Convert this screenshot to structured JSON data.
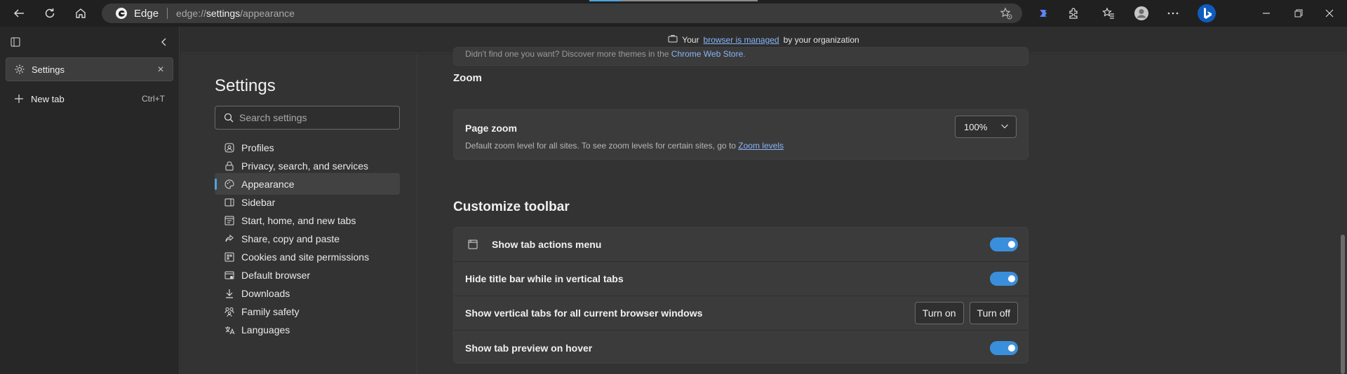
{
  "browser": {
    "name": "Edge",
    "url_prefix": "edge://",
    "url_main": "settings",
    "url_suffix": "/appearance"
  },
  "vertical_tabs": {
    "tabs": [
      {
        "label": "Settings",
        "close": "✕"
      },
      {
        "label": "New tab",
        "shortcut": "Ctrl+T"
      }
    ]
  },
  "banner": {
    "prefix": "Your",
    "link": "browser is managed",
    "suffix": "by your organization"
  },
  "settings": {
    "title": "Settings",
    "search_placeholder": "Search settings",
    "nav": [
      {
        "label": "Profiles"
      },
      {
        "label": "Privacy, search, and services"
      },
      {
        "label": "Appearance"
      },
      {
        "label": "Sidebar"
      },
      {
        "label": "Start, home, and new tabs"
      },
      {
        "label": "Share, copy and paste"
      },
      {
        "label": "Cookies and site permissions"
      },
      {
        "label": "Default browser"
      },
      {
        "label": "Downloads"
      },
      {
        "label": "Family safety"
      },
      {
        "label": "Languages"
      }
    ]
  },
  "content": {
    "themes_hint": "Didn't find one you want? Discover more themes in the",
    "themes_link": "Chrome Web Store",
    "themes_end": ".",
    "zoom_heading": "Zoom",
    "page_zoom_label": "Page zoom",
    "page_zoom_desc": "Default zoom level for all sites. To see zoom levels for certain sites, go to",
    "zoom_levels_link": "Zoom levels",
    "zoom_value": "100%",
    "toolbar_heading": "Customize toolbar",
    "rows": [
      {
        "label": "Show tab actions menu"
      },
      {
        "label": "Hide title bar while in vertical tabs"
      },
      {
        "label": "Show vertical tabs for all current browser windows",
        "btn_on": "Turn on",
        "btn_off": "Turn off"
      },
      {
        "label": "Show tab preview on hover"
      }
    ]
  },
  "colors": {
    "accent": "#3a8fdc",
    "link": "#8ab4f8"
  }
}
